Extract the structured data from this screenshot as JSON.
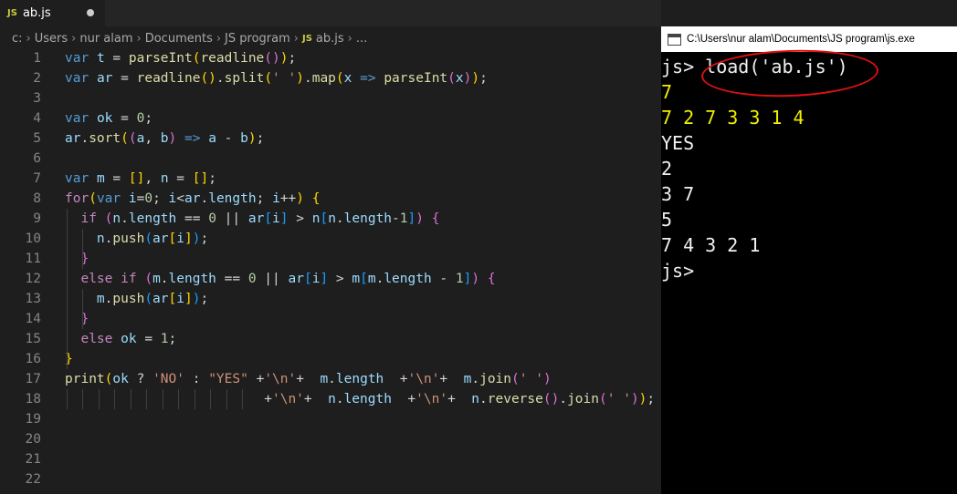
{
  "editor": {
    "tab": {
      "icon": "JS",
      "filename": "ab.js",
      "modified_icon": "unsaved-dot-icon"
    },
    "breadcrumb": {
      "parts": [
        "c:",
        "Users",
        "nur alam",
        "Documents",
        "JS program"
      ],
      "js_icon": "JS",
      "file": "ab.js",
      "more": "..."
    },
    "lines": [
      {
        "n": "1"
      },
      {
        "n": "2"
      },
      {
        "n": "3"
      },
      {
        "n": "4"
      },
      {
        "n": "5"
      },
      {
        "n": "6"
      },
      {
        "n": "7"
      },
      {
        "n": "8"
      },
      {
        "n": "9"
      },
      {
        "n": "10"
      },
      {
        "n": "11"
      },
      {
        "n": "12"
      },
      {
        "n": "13"
      },
      {
        "n": "14"
      },
      {
        "n": "15"
      },
      {
        "n": "16"
      },
      {
        "n": "17"
      },
      {
        "n": "18"
      },
      {
        "n": "19"
      },
      {
        "n": "20"
      },
      {
        "n": "21"
      },
      {
        "n": "22"
      }
    ],
    "code": [
      [
        [
          "kw",
          "var"
        ],
        [
          null,
          " "
        ],
        [
          "vr",
          "t"
        ],
        [
          null,
          " = "
        ],
        [
          "fn",
          "parseInt"
        ],
        [
          "b1",
          "("
        ],
        [
          "fn",
          "readline"
        ],
        [
          "b2",
          "()"
        ],
        [
          "b1",
          ")"
        ],
        [
          null,
          ";"
        ]
      ],
      [
        [
          "kw",
          "var"
        ],
        [
          null,
          " "
        ],
        [
          "vr",
          "ar"
        ],
        [
          null,
          " = "
        ],
        [
          "fn",
          "readline"
        ],
        [
          "b1",
          "()"
        ],
        [
          null,
          "."
        ],
        [
          "fn",
          "split"
        ],
        [
          "b1",
          "("
        ],
        [
          "str",
          "' '"
        ],
        [
          "b1",
          ")"
        ],
        [
          null,
          "."
        ],
        [
          "fn",
          "map"
        ],
        [
          "b1",
          "("
        ],
        [
          "vr",
          "x"
        ],
        [
          null,
          " "
        ],
        [
          "kw",
          "=>"
        ],
        [
          null,
          " "
        ],
        [
          "fn",
          "parseInt"
        ],
        [
          "b2",
          "("
        ],
        [
          "vr",
          "x"
        ],
        [
          "b2",
          ")"
        ],
        [
          "b1",
          ")"
        ],
        [
          null,
          ";"
        ]
      ],
      [],
      [
        [
          "kw",
          "var"
        ],
        [
          null,
          " "
        ],
        [
          "vr",
          "ok"
        ],
        [
          null,
          " = "
        ],
        [
          "num",
          "0"
        ],
        [
          null,
          ";"
        ]
      ],
      [
        [
          "vr",
          "ar"
        ],
        [
          null,
          "."
        ],
        [
          "fn",
          "sort"
        ],
        [
          "b1",
          "("
        ],
        [
          "b2",
          "("
        ],
        [
          "vr",
          "a"
        ],
        [
          null,
          ", "
        ],
        [
          "vr",
          "b"
        ],
        [
          "b2",
          ")"
        ],
        [
          null,
          " "
        ],
        [
          "kw",
          "=>"
        ],
        [
          null,
          " "
        ],
        [
          "vr",
          "a"
        ],
        [
          null,
          " - "
        ],
        [
          "vr",
          "b"
        ],
        [
          "b1",
          ")"
        ],
        [
          null,
          ";"
        ]
      ],
      [],
      [
        [
          "kw",
          "var"
        ],
        [
          null,
          " "
        ],
        [
          "vr",
          "m"
        ],
        [
          null,
          " = "
        ],
        [
          "b1",
          "[]"
        ],
        [
          null,
          ", "
        ],
        [
          "vr",
          "n"
        ],
        [
          null,
          " = "
        ],
        [
          "b1",
          "[]"
        ],
        [
          null,
          ";"
        ]
      ],
      [
        [
          "ctl",
          "for"
        ],
        [
          "b1",
          "("
        ],
        [
          "kw",
          "var"
        ],
        [
          null,
          " "
        ],
        [
          "vr",
          "i"
        ],
        [
          null,
          "="
        ],
        [
          "num",
          "0"
        ],
        [
          null,
          "; "
        ],
        [
          "vr",
          "i"
        ],
        [
          null,
          "<"
        ],
        [
          "vr",
          "ar"
        ],
        [
          null,
          "."
        ],
        [
          "vr",
          "length"
        ],
        [
          null,
          "; "
        ],
        [
          "vr",
          "i"
        ],
        [
          null,
          "++"
        ],
        [
          "b1",
          ")"
        ],
        [
          null,
          " "
        ],
        [
          "b1",
          "{"
        ]
      ],
      [
        [
          null,
          "  "
        ],
        [
          "ctl",
          "if"
        ],
        [
          null,
          " "
        ],
        [
          "b2",
          "("
        ],
        [
          "vr",
          "n"
        ],
        [
          null,
          "."
        ],
        [
          "vr",
          "length"
        ],
        [
          null,
          " == "
        ],
        [
          "num",
          "0"
        ],
        [
          null,
          " || "
        ],
        [
          "vr",
          "ar"
        ],
        [
          "b3",
          "["
        ],
        [
          "vr",
          "i"
        ],
        [
          "b3",
          "]"
        ],
        [
          null,
          " > "
        ],
        [
          "vr",
          "n"
        ],
        [
          "b3",
          "["
        ],
        [
          "vr",
          "n"
        ],
        [
          null,
          "."
        ],
        [
          "vr",
          "length"
        ],
        [
          null,
          "-"
        ],
        [
          "num",
          "1"
        ],
        [
          "b3",
          "]"
        ],
        [
          "b2",
          ")"
        ],
        [
          null,
          " "
        ],
        [
          "b2",
          "{"
        ]
      ],
      [
        [
          null,
          "    "
        ],
        [
          "vr",
          "n"
        ],
        [
          null,
          "."
        ],
        [
          "fn",
          "push"
        ],
        [
          "b3",
          "("
        ],
        [
          "vr",
          "ar"
        ],
        [
          "b1",
          "["
        ],
        [
          "vr",
          "i"
        ],
        [
          "b1",
          "]"
        ],
        [
          "b3",
          ")"
        ],
        [
          null,
          ";"
        ]
      ],
      [
        [
          null,
          "  "
        ],
        [
          "b2",
          "}"
        ]
      ],
      [
        [
          null,
          "  "
        ],
        [
          "ctl",
          "else"
        ],
        [
          null,
          " "
        ],
        [
          "ctl",
          "if"
        ],
        [
          null,
          " "
        ],
        [
          "b2",
          "("
        ],
        [
          "vr",
          "m"
        ],
        [
          null,
          "."
        ],
        [
          "vr",
          "length"
        ],
        [
          null,
          " == "
        ],
        [
          "num",
          "0"
        ],
        [
          null,
          " || "
        ],
        [
          "vr",
          "ar"
        ],
        [
          "b3",
          "["
        ],
        [
          "vr",
          "i"
        ],
        [
          "b3",
          "]"
        ],
        [
          null,
          " > "
        ],
        [
          "vr",
          "m"
        ],
        [
          "b3",
          "["
        ],
        [
          "vr",
          "m"
        ],
        [
          null,
          "."
        ],
        [
          "vr",
          "length"
        ],
        [
          null,
          " - "
        ],
        [
          "num",
          "1"
        ],
        [
          "b3",
          "]"
        ],
        [
          "b2",
          ")"
        ],
        [
          null,
          " "
        ],
        [
          "b2",
          "{"
        ]
      ],
      [
        [
          null,
          "    "
        ],
        [
          "vr",
          "m"
        ],
        [
          null,
          "."
        ],
        [
          "fn",
          "push"
        ],
        [
          "b3",
          "("
        ],
        [
          "vr",
          "ar"
        ],
        [
          "b1",
          "["
        ],
        [
          "vr",
          "i"
        ],
        [
          "b1",
          "]"
        ],
        [
          "b3",
          ")"
        ],
        [
          null,
          ";"
        ]
      ],
      [
        [
          null,
          "  "
        ],
        [
          "b2",
          "}"
        ]
      ],
      [
        [
          null,
          "  "
        ],
        [
          "ctl",
          "else"
        ],
        [
          null,
          " "
        ],
        [
          "vr",
          "ok"
        ],
        [
          null,
          " = "
        ],
        [
          "num",
          "1"
        ],
        [
          null,
          ";"
        ]
      ],
      [
        [
          "b1",
          "}"
        ]
      ],
      [
        [
          "fn",
          "print"
        ],
        [
          "b1",
          "("
        ],
        [
          "vr",
          "ok"
        ],
        [
          null,
          " ? "
        ],
        [
          "str",
          "'NO'"
        ],
        [
          null,
          " : "
        ],
        [
          "str",
          "\"YES\""
        ],
        [
          null,
          " +"
        ],
        [
          "str",
          "'\\n'"
        ],
        [
          null,
          "+  "
        ],
        [
          "vr",
          "m"
        ],
        [
          null,
          "."
        ],
        [
          "vr",
          "length"
        ],
        [
          null,
          "  +"
        ],
        [
          "str",
          "'\\n'"
        ],
        [
          null,
          "+  "
        ],
        [
          "vr",
          "m"
        ],
        [
          null,
          "."
        ],
        [
          "fn",
          "join"
        ],
        [
          "b2",
          "("
        ],
        [
          "str",
          "' '"
        ],
        [
          "b2",
          ")"
        ]
      ],
      [
        [
          null,
          "                         +"
        ],
        [
          "str",
          "'\\n'"
        ],
        [
          null,
          "+  "
        ],
        [
          "vr",
          "n"
        ],
        [
          null,
          "."
        ],
        [
          "vr",
          "length"
        ],
        [
          null,
          "  +"
        ],
        [
          "str",
          "'\\n'"
        ],
        [
          null,
          "+  "
        ],
        [
          "vr",
          "n"
        ],
        [
          null,
          "."
        ],
        [
          "fn",
          "reverse"
        ],
        [
          "b2",
          "()"
        ],
        [
          null,
          "."
        ],
        [
          "fn",
          "join"
        ],
        [
          "b2",
          "("
        ],
        [
          "str",
          "' '"
        ],
        [
          "b2",
          ")"
        ],
        [
          "b1",
          ")"
        ],
        [
          null,
          ";"
        ]
      ],
      [],
      [],
      [],
      []
    ]
  },
  "console": {
    "title": "C:\\Users\\nur alam\\Documents\\JS program\\js.exe",
    "icon": "console-window-icon",
    "lines": [
      {
        "text": "js> load('ab.js')",
        "color": "#f0f0f0"
      },
      {
        "text": "7",
        "color": "#f0f000"
      },
      {
        "text": "7 2 7 3 3 1 4",
        "color": "#f0f000"
      },
      {
        "text": "YES",
        "color": "#f0f0f0"
      },
      {
        "text": "2",
        "color": "#f0f0f0"
      },
      {
        "text": "3 7",
        "color": "#f0f0f0"
      },
      {
        "text": "5",
        "color": "#f0f0f0"
      },
      {
        "text": "7 4 3 2 1",
        "color": "#f0f0f0"
      },
      {
        "text": "js>",
        "color": "#f0f0f0"
      }
    ],
    "annotation_color": "#e01010"
  },
  "colors": {
    "editor_bg": "#1e1e1e",
    "keyword": "#569cd6",
    "function": "#dcdcaa",
    "variable": "#9cdcfe",
    "number": "#b5cea8",
    "string": "#ce9178",
    "control": "#c586c0",
    "console_bg": "#000000",
    "console_input": "#f0f000"
  }
}
